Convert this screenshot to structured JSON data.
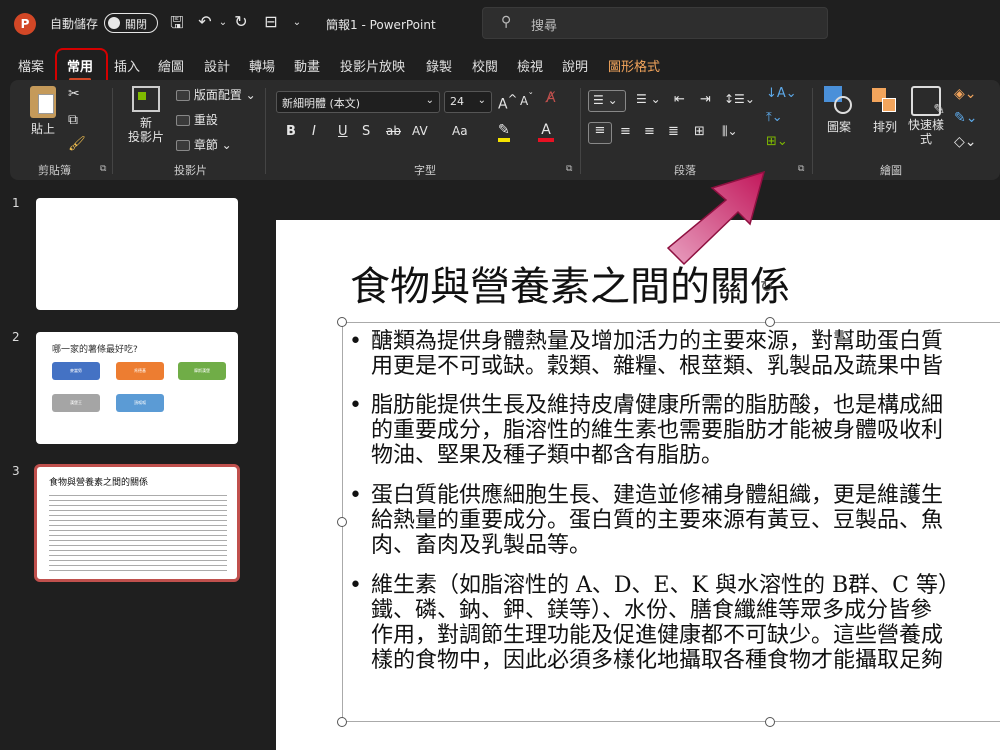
{
  "titlebar": {
    "logo": "P",
    "autosave_label": "自動儲存",
    "toggle_label": "關閉",
    "doc_title": "簡報1 - PowerPoint",
    "search_placeholder": "搜尋"
  },
  "tabs": [
    "檔案",
    "常用",
    "插入",
    "繪圖",
    "設計",
    "轉場",
    "動畫",
    "投影片放映",
    "錄製",
    "校閱",
    "檢視",
    "說明",
    "圖形格式"
  ],
  "ribbon": {
    "clipboard": {
      "paste": "貼上",
      "label": "剪貼簿"
    },
    "slides": {
      "new_slide": "新\n投影片",
      "layout": "版面配置",
      "reset": "重設",
      "section": "章節",
      "label": "投影片"
    },
    "font": {
      "font_name": "新細明體 (本文)",
      "font_size": "24",
      "bold": "B",
      "italic": "I",
      "underline": "U",
      "shadow": "S",
      "strike": "ab",
      "spacing": "AV",
      "case": "Aa",
      "label": "字型"
    },
    "paragraph": {
      "label": "段落"
    },
    "drawing": {
      "shapes": "圖案",
      "arrange": "排列",
      "quick_styles": "快速樣\n式",
      "label": "繪圖"
    }
  },
  "thumbnails": [
    {
      "num": "1"
    },
    {
      "num": "2",
      "title": "哪一家的薯條最好吃?",
      "buttons": [
        {
          "color": "#4472c4",
          "label": "麥當勞"
        },
        {
          "color": "#ed7d31",
          "label": "肯德基"
        },
        {
          "color": "#70ad47",
          "label": "摩斯漢堡"
        },
        {
          "color": "#a5a5a5",
          "label": "漢堡王"
        },
        {
          "color": "#5b9bd5",
          "label": "頂呱呱"
        }
      ]
    },
    {
      "num": "3",
      "title": "食物與營養素之間的關係"
    }
  ],
  "slide": {
    "title": "食物與營養素之間的關係",
    "bullets": [
      {
        "lines": [
          "醣類為提供身體熱量及增加活力的主要來源，對幫助蛋白質",
          "用更是不可或缺。穀類、雜糧、根莖類、乳製品及蔬果中皆"
        ]
      },
      {
        "lines": [
          "脂肪能提供生長及維持皮膚健康所需的脂肪酸，也是構成細",
          "的重要成分，脂溶性的維生素也需要脂肪才能被身體吸收利",
          "物油、堅果及種子類中都含有脂肪。"
        ]
      },
      {
        "lines": [
          "蛋白質能供應細胞生長、建造並修補身體組織，更是維護生",
          "給熱量的重要成分。蛋白質的主要來源有黃豆、豆製品、魚",
          "肉、畜肉及乳製品等。"
        ]
      },
      {
        "lines": [
          "維生素（如脂溶性的 A、D、E、K 與水溶性的 B群、C 等）",
          "鐵、磷、鈉、鉀、鎂等）、水份、膳食纖維等眾多成分皆參",
          "作用，對調節生理功能及促進健康都不可缺少。這些營養成",
          "樣的食物中，因此必須多樣化地攝取各種食物才能攝取足夠"
        ]
      }
    ]
  },
  "colors": {
    "accent": "#d24726",
    "highlight": "#d40000",
    "arrow": "#c2185b"
  }
}
